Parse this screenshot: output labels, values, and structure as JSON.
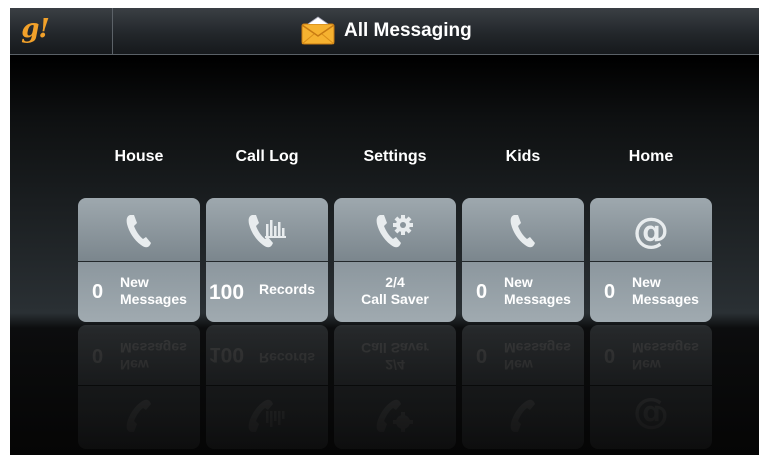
{
  "app": {
    "logo": "g!",
    "title": "All Messaging"
  },
  "tiles": [
    {
      "label": "House",
      "icon": "phone-icon",
      "count": "0",
      "desc_line1": "New",
      "desc_line2": "Messages"
    },
    {
      "label": "Call Log",
      "icon": "call-log-icon",
      "count": "100",
      "desc_line1": "Records",
      "desc_line2": ""
    },
    {
      "label": "Settings",
      "icon": "phone-gear-icon",
      "count": "",
      "desc_line1": "2/4",
      "desc_line2": "Call Saver"
    },
    {
      "label": "Kids",
      "icon": "phone-icon",
      "count": "0",
      "desc_line1": "New",
      "desc_line2": "Messages"
    },
    {
      "label": "Home",
      "icon": "at-sign-icon",
      "count": "0",
      "desc_line1": "New",
      "desc_line2": "Messages"
    }
  ],
  "colors": {
    "logo": "#f2a12a",
    "tile": "#8c979e",
    "icon": "#e8ecee"
  }
}
